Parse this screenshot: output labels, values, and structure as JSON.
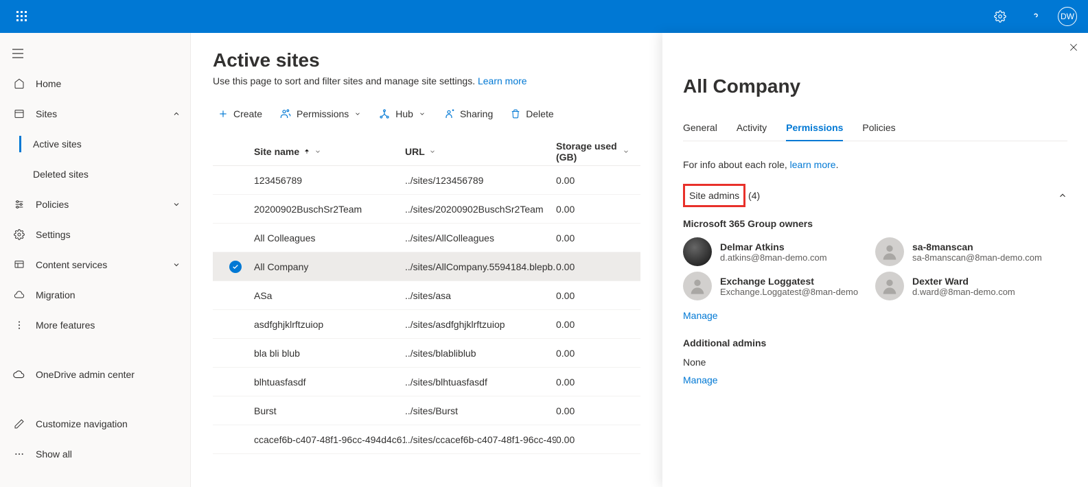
{
  "topbar": {
    "avatar": "DW"
  },
  "sidebar": {
    "items": [
      {
        "label": "Home"
      },
      {
        "label": "Sites"
      },
      {
        "label": "Active sites"
      },
      {
        "label": "Deleted sites"
      },
      {
        "label": "Policies"
      },
      {
        "label": "Settings"
      },
      {
        "label": "Content services"
      },
      {
        "label": "Migration"
      },
      {
        "label": "More features"
      },
      {
        "label": "OneDrive admin center"
      },
      {
        "label": "Customize navigation"
      },
      {
        "label": "Show all"
      }
    ]
  },
  "page": {
    "title": "Active sites",
    "desc": "Use this page to sort and filter sites and manage site settings. ",
    "learn": "Learn more"
  },
  "cmd": {
    "create": "Create",
    "permissions": "Permissions",
    "hub": "Hub",
    "sharing": "Sharing",
    "delete": "Delete"
  },
  "cols": {
    "name": "Site name",
    "url": "URL",
    "storage": "Storage used (GB)"
  },
  "rows": [
    {
      "name": "123456789",
      "url": "../sites/123456789",
      "stor": "0.00"
    },
    {
      "name": "20200902BuschSr2Team",
      "url": "../sites/20200902BuschSr2Team",
      "stor": "0.00"
    },
    {
      "name": "All Colleagues",
      "url": "../sites/AllColleagues",
      "stor": "0.00"
    },
    {
      "name": "All Company",
      "url": "../sites/AllCompany.5594184.blepb...",
      "stor": "0.00"
    },
    {
      "name": "ASa",
      "url": "../sites/asa",
      "stor": "0.00"
    },
    {
      "name": "asdfghjklrftzuiop",
      "url": "../sites/asdfghjklrftzuiop",
      "stor": "0.00"
    },
    {
      "name": "bla bli blub",
      "url": "../sites/blabliblub",
      "stor": "0.00"
    },
    {
      "name": "blhtuasfasdf",
      "url": "../sites/blhtuasfasdf",
      "stor": "0.00"
    },
    {
      "name": "Burst",
      "url": "../sites/Burst",
      "stor": "0.00"
    },
    {
      "name": "ccacef6b-c407-48f1-96cc-494d4c61...",
      "url": "../sites/ccacef6b-c407-48f1-96cc-49...",
      "stor": "0.00"
    }
  ],
  "panel": {
    "title": "All Company",
    "tabs": {
      "general": "General",
      "activity": "Activity",
      "permissions": "Permissions",
      "policies": "Policies"
    },
    "info_pre": "For info about each role, ",
    "info_link": "learn more",
    "site_admins_label": "Site admins",
    "site_admins_count": "(4)",
    "group_title": "Microsoft 365 Group owners",
    "admins": [
      {
        "name": "Delmar Atkins",
        "email": "d.atkins@8man-demo.com",
        "dark": true
      },
      {
        "name": "sa-8manscan",
        "email": "sa-8manscan@8man-demo.com"
      },
      {
        "name": "Exchange Loggatest",
        "email": "Exchange.Loggatest@8man-demo"
      },
      {
        "name": "Dexter Ward",
        "email": "d.ward@8man-demo.com"
      }
    ],
    "manage": "Manage",
    "additional_title": "Additional admins",
    "none": "None"
  }
}
